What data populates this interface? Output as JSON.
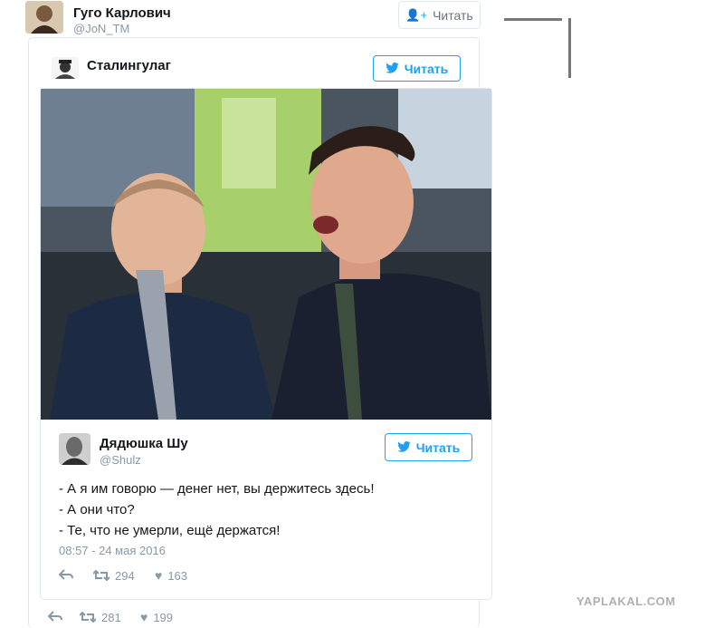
{
  "outer_tweet": {
    "name": "Гуго Карлович",
    "handle": "@JoN_TM",
    "follow_label": "Читать",
    "retweets": "281",
    "likes": "199"
  },
  "middle_tweet": {
    "name": "Сталингулаг",
    "follow_label": "Читать"
  },
  "inner_tweet": {
    "name": "Дядюшка Шу",
    "handle": "@Shulz",
    "follow_label": "Читать",
    "text_lines": [
      "- А я им говорю — денег нет, вы держитесь здесь!",
      "- А они что?",
      "- Те, что не умерли, ещё держатся!"
    ],
    "timestamp": "08:57 - 24 мая 2016",
    "retweets": "294",
    "likes": "163"
  },
  "watermark": "YAPLAKAL.COM",
  "colors": {
    "twitter_blue": "#1da1f2",
    "muted": "#8899a6",
    "border": "#e1e8ed"
  }
}
